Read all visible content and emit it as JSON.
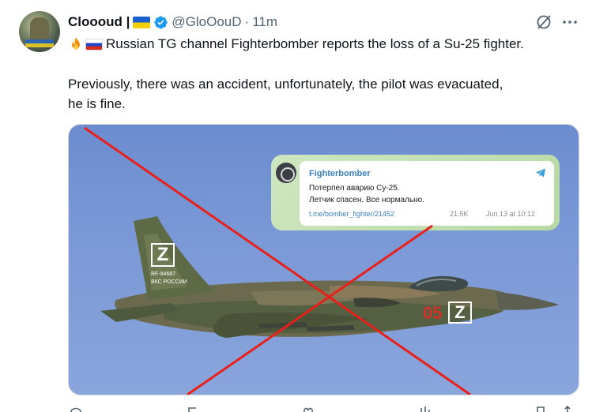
{
  "tweet": {
    "author_name": "Cloooud |",
    "handle": "@GloOouD",
    "separator": "·",
    "time": "11m",
    "line1": "Russian TG channel Fighterbomber reports the loss of a Su-25 fighter.",
    "line2": "Previously, there was an accident, unfortunately, the pilot was evacuated,",
    "line3": "he is fine."
  },
  "icons": {
    "verified": "verified-badge-icon",
    "grok": "grok-icon",
    "more": "more-icon",
    "fire": "fire-emoji",
    "flag_ua": "ukraine-flag",
    "flag_ru": "russia-flag"
  },
  "telegram_card": {
    "channel": "Fighterbomber",
    "message_line1": "Потерпел аварию Су-25.",
    "message_line2": "Летчик спасен. Все нормально.",
    "link": "t.me/bomber_fighter/21452",
    "views": "21.5K",
    "date": "Jun 13 at 10:12"
  },
  "plane_markings": {
    "tail_letter": "Z",
    "tail_code": "RF-94687",
    "tail_text": "ВКС РОССИИ",
    "side_number": "05",
    "side_letter": "Z"
  },
  "colors": {
    "accent": "#1d9bf0",
    "cross": "#e8201a",
    "sky": "#7a98d6"
  }
}
